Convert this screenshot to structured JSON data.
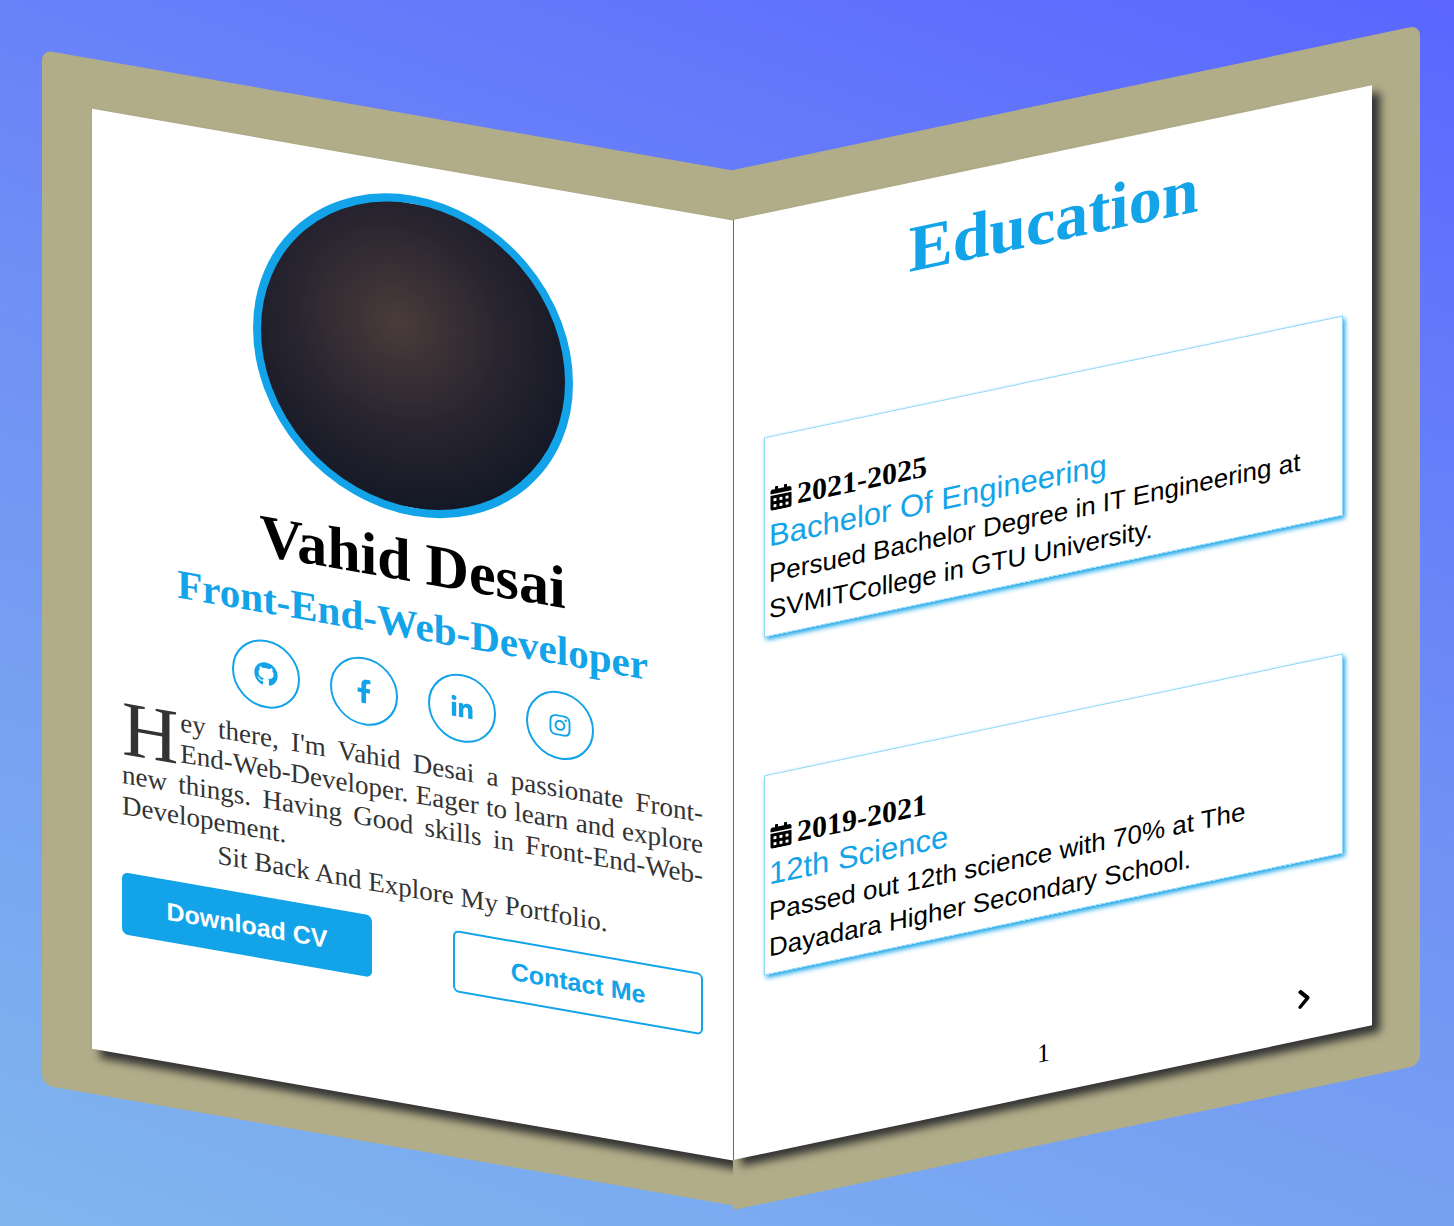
{
  "profile": {
    "name": "Vahid Desai",
    "role": "Front-End-Web-Developer",
    "intro": "Hey there, I'm Vahid Desai a passionate Front-End-Web-Developer. Eager to learn and explore new things. Having Good skills in Front-End-Web-Developement.",
    "tagline": "Sit Back And Explore My Portfolio."
  },
  "buttons": [
    {
      "label": "Download CV",
      "kind": "primary"
    },
    {
      "label": "Contact Me",
      "kind": "outline"
    }
  ],
  "education": {
    "title": "Education",
    "items": [
      {
        "years": "2021-2025",
        "degree": "Bachelor Of Engineering",
        "description": "Persued Bachelor Degree in IT Engineering at SVMITCollege in GTU University."
      },
      {
        "years": "2019-2021",
        "degree": "12th Science",
        "description": "Passed out 12th science with 70% at The Dayadara Higher Secondary School."
      }
    ],
    "page": "1"
  }
}
